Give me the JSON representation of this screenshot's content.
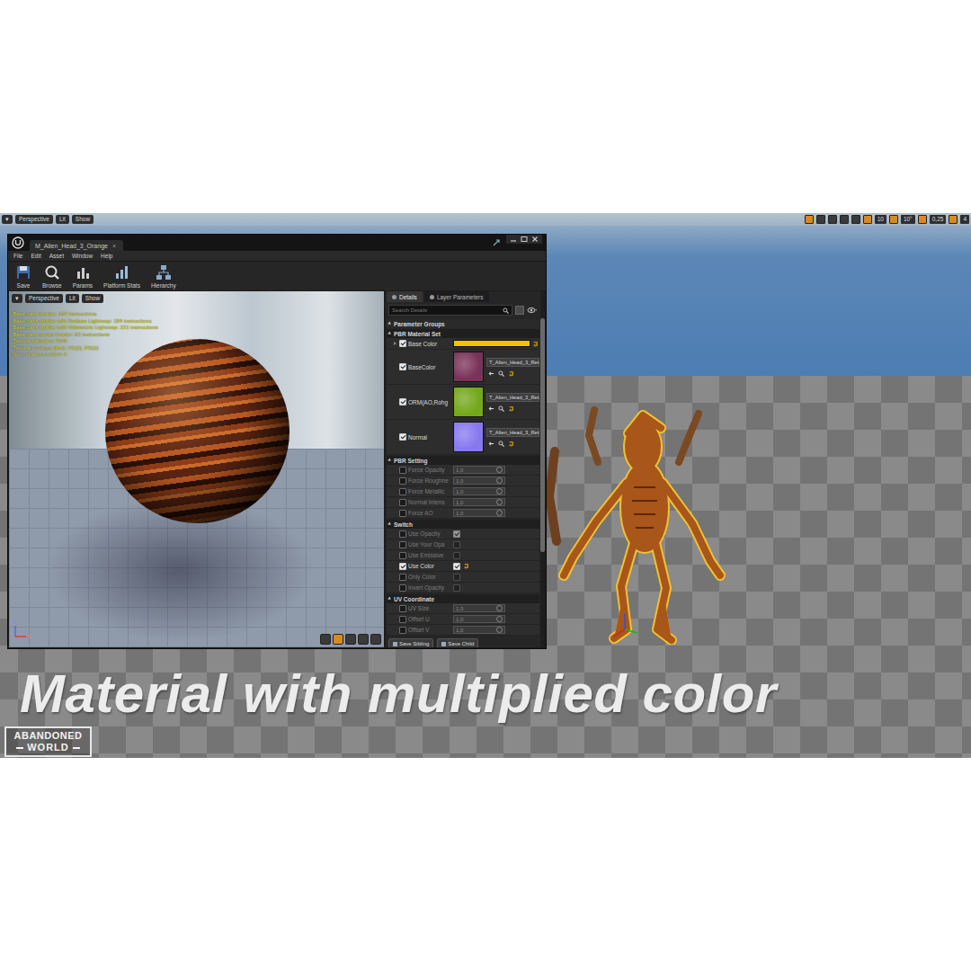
{
  "viewport": {
    "view_menu": "▾",
    "toolbar_left": [
      "Perspective",
      "Lit",
      "Show"
    ],
    "toolbar_right": [
      "10",
      "10°",
      "0,25",
      "4"
    ]
  },
  "editor": {
    "title": "M_Alien_Head_3_Orange",
    "close_tab": "×",
    "menu": [
      "File",
      "Edit",
      "Asset",
      "Window",
      "Help"
    ],
    "toolbar": [
      "Save",
      "Browse",
      "Params",
      "Platform Stats",
      "Hierarchy"
    ]
  },
  "preview": {
    "view_menu": "▾",
    "buttons": [
      "Perspective",
      "Lit",
      "Show"
    ],
    "stats": [
      "Base pass shader: 184 instructions",
      "Base pass shader with Surface Lightmap: 184 instructions",
      "Base pass shader with Volumetric Lightmap: 221 instructions",
      "Base pass vertex shader: 62 instructions",
      "Texture samplers: 5/16",
      "Texture Lookups (Est): VS(0), PS(3)",
      "Num shaders added: 4"
    ],
    "axes": [
      "Z",
      "X"
    ]
  },
  "details": {
    "tabs": [
      {
        "label": "Details",
        "selected": true
      },
      {
        "label": "Layer Parameters",
        "selected": false
      }
    ],
    "search_placeholder": "Search Details",
    "root": {
      "label": "Parameter Groups",
      "expanded": true
    },
    "groups": [
      {
        "title": "PBR Material Set",
        "expanded": true,
        "rows": [
          {
            "kind": "color",
            "label": "Base Color",
            "checked": true,
            "color": "#f2c300"
          },
          {
            "kind": "texture",
            "label": "BaseColor",
            "checked": true,
            "asset": "T_Alien_Head_3_Ret",
            "color": "#7a3358"
          },
          {
            "kind": "texture",
            "label": "ORM(AO,Rohg",
            "checked": true,
            "asset": "T_Alien_Head_3_Ret",
            "color": "#74a81c"
          },
          {
            "kind": "texture",
            "label": "Normal",
            "checked": true,
            "asset": "T_Alien_Head_3_Ret",
            "color": "#8878f0"
          }
        ]
      },
      {
        "title": "PBR Setting",
        "expanded": true,
        "rows": [
          {
            "kind": "number",
            "label": "Force Opacity",
            "checked": false,
            "value": "1,0"
          },
          {
            "kind": "number",
            "label": "Force Roughne",
            "checked": false,
            "value": "1,0"
          },
          {
            "kind": "number",
            "label": "Force Metallic",
            "checked": false,
            "value": "1,0"
          },
          {
            "kind": "number",
            "label": "Normal Intens",
            "checked": false,
            "value": "1,0"
          },
          {
            "kind": "number",
            "label": "Force AO",
            "checked": false,
            "value": "1,0"
          }
        ]
      },
      {
        "title": "Switch",
        "expanded": true,
        "rows": [
          {
            "kind": "switch",
            "label": "Use Opacity",
            "checked": false,
            "value": true
          },
          {
            "kind": "switch",
            "label": "Use Your Opa",
            "checked": false,
            "value": false
          },
          {
            "kind": "switch",
            "label": "Use Emissive",
            "checked": false,
            "value": false
          },
          {
            "kind": "switch",
            "label": "Use Color",
            "checked": true,
            "value": true
          },
          {
            "kind": "switch",
            "label": "Only Color",
            "checked": false,
            "value": false
          },
          {
            "kind": "switch",
            "label": "Invert Opacity",
            "checked": false,
            "value": false
          }
        ]
      },
      {
        "title": "UV Coordinate",
        "expanded": true,
        "rows": [
          {
            "kind": "number",
            "label": "UV Size",
            "checked": false,
            "value": "1,0"
          },
          {
            "kind": "number",
            "label": "Offset U",
            "checked": false,
            "value": "1,0"
          },
          {
            "kind": "number",
            "label": "Offset V",
            "checked": false,
            "value": "1,0"
          }
        ]
      }
    ]
  },
  "buttons": [
    "Save Sibling",
    "Save Child"
  ],
  "caption": "Material with multiplied color",
  "logo": {
    "top": "ABANDONED",
    "bottom": "WORLD"
  }
}
